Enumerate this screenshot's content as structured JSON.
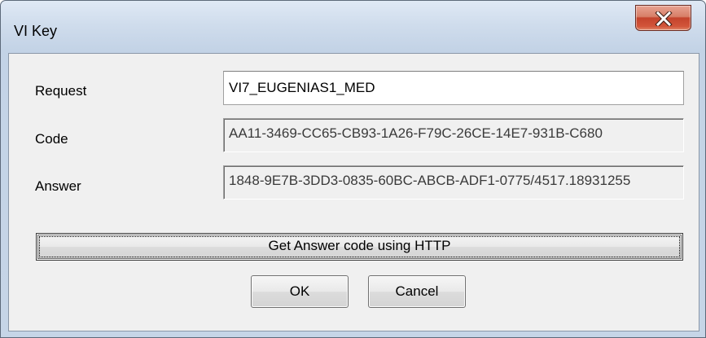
{
  "window": {
    "title": "VI Key"
  },
  "form": {
    "request_label": "Request",
    "request_value": "VI7_EUGENIAS1_MED",
    "code_label": "Code",
    "code_value": "AA11-3469-CC65-CB93-1A26-F79C-26CE-14E7-931B-C680",
    "answer_label": "Answer",
    "answer_value": "1848-9E7B-3DD3-0835-60BC-ABCB-ADF1-0775/4517.18931255"
  },
  "buttons": {
    "http_label": "Get Answer code using HTTP",
    "ok_label": "OK",
    "cancel_label": "Cancel"
  },
  "icons": {
    "close": "close-icon"
  },
  "colors": {
    "close_button": "#c4432c",
    "frame": "#c6d5e7",
    "client": "#f0f0f0"
  }
}
